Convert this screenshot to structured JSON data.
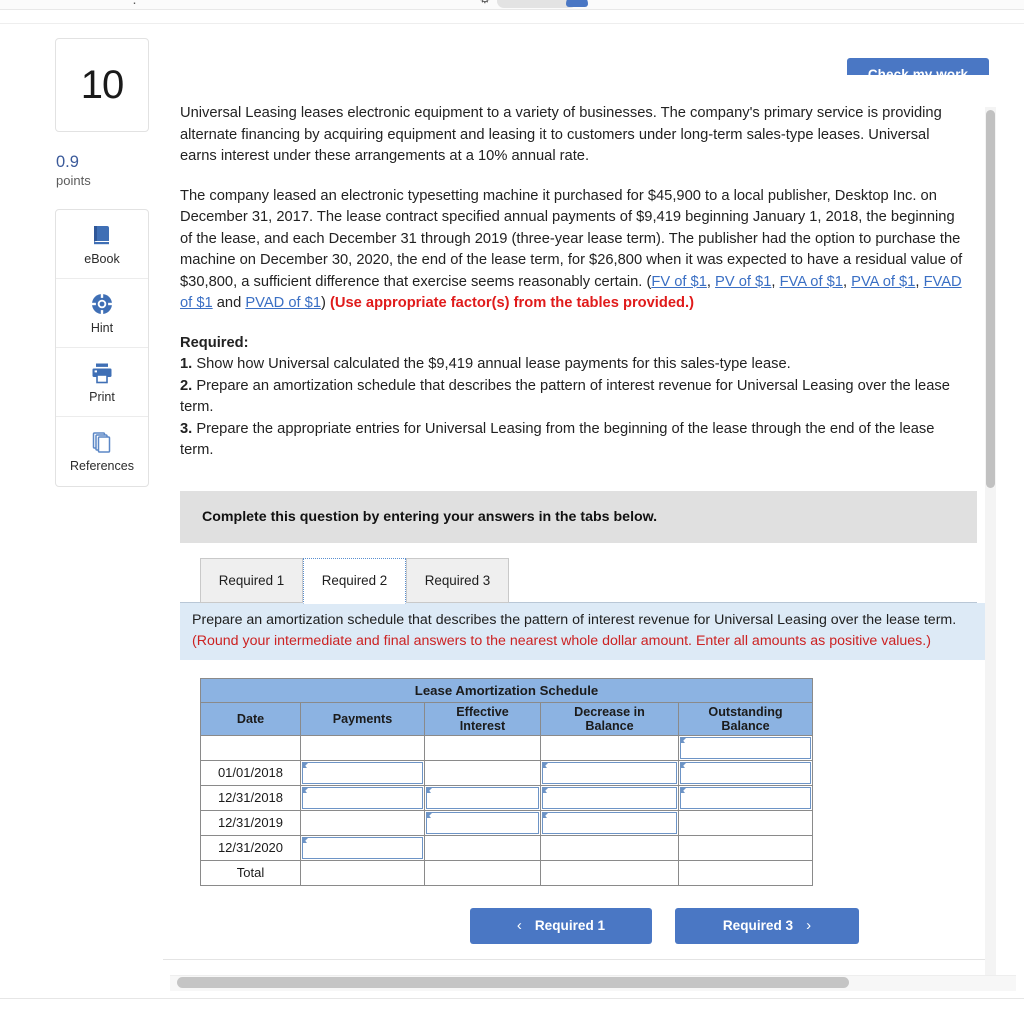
{
  "toolbar": {
    "blue_marker_icon": "blue-bookmark-icon",
    "pill_icon": "grey-pill-tab",
    "glyphs": [
      "search-icon",
      "menu-icon"
    ]
  },
  "header": {
    "check_my_work_label": "Check my work"
  },
  "sidebar": {
    "question_number": "10",
    "points_value": "0.9",
    "points_label": "points",
    "tools": [
      {
        "icon": "ebook-icon",
        "label": "eBook"
      },
      {
        "icon": "hint-lifering-icon",
        "label": "Hint"
      },
      {
        "icon": "printer-icon",
        "label": "Print"
      },
      {
        "icon": "references-copy-icon",
        "label": "References"
      }
    ]
  },
  "question": {
    "paragraph1": "Universal Leasing leases electronic equipment to a variety of businesses. The company's primary service is providing alternate financing by acquiring equipment and leasing it to customers under long-term sales-type leases. Universal earns interest under these arrangements at a 10% annual rate.",
    "paragraph2_pre": "The company leased an electronic typesetting machine it purchased for $45,900 to a local publisher, Desktop Inc. on December 31, 2017. The lease contract specified annual payments of $9,419 beginning January 1, 2018, the beginning of the lease, and each December 31 through 2019 (three-year lease term). The publisher had the option to purchase the machine on December 30, 2020, the end of the lease term, for $26,800 when it was expected to have a residual value of $30,800, a sufficient difference that exercise seems reasonably certain. (",
    "links": [
      "FV of $1",
      "PV of $1",
      "FVA of $1",
      "PVA of $1",
      "FVAD of $1",
      "PVAD of $1"
    ],
    "link_joiner": " and ",
    "paragraph2_close": ") ",
    "use_factors_note": "(Use appropriate factor(s) from the tables provided.)",
    "required_heading": "Required:",
    "req1_num": "1.",
    "req1_text": " Show how Universal calculated the $9,419 annual lease payments for this sales-type lease.",
    "req2_num": "2.",
    "req2_text": " Prepare an amortization schedule that describes the pattern of interest revenue for Universal Leasing over the lease term.",
    "req3_num": "3.",
    "req3_text": " Prepare the appropriate entries for Universal Leasing from the beginning of the lease through the end of the lease term."
  },
  "answer_area": {
    "banner": "Complete this question by entering your answers in the tabs below.",
    "tabs": [
      {
        "label": "Required 1",
        "active": false
      },
      {
        "label": "Required 2",
        "active": true
      },
      {
        "label": "Required 3",
        "active": false
      }
    ],
    "instruction_line1": "Prepare an amortization schedule that describes the pattern of interest revenue for Universal Leasing over the lease term.",
    "instruction_line2": "(Round your intermediate and final answers to the nearest whole dollar amount. Enter all amounts as positive values.)",
    "prev_button": "Required 1",
    "next_button": "Required 3",
    "prev_chevron": "‹",
    "next_chevron": "›"
  },
  "table": {
    "title": "Lease Amortization Schedule",
    "columns": [
      "Date",
      "Payments",
      "Effective Interest",
      "Decrease in Balance",
      "Outstanding Balance"
    ],
    "column_lines": [
      [
        "Date"
      ],
      [
        "Payments"
      ],
      [
        "Effective",
        "Interest"
      ],
      [
        "Decrease in",
        "Balance"
      ],
      [
        "Outstanding",
        "Balance"
      ]
    ],
    "rows": [
      {
        "date": "",
        "payments": "",
        "effective_interest": "",
        "decrease_in_balance": "",
        "outstanding_balance": "",
        "editable": [
          false,
          false,
          false,
          true
        ]
      },
      {
        "date": "01/01/2018",
        "payments": "",
        "effective_interest": "",
        "decrease_in_balance": "",
        "outstanding_balance": "",
        "editable": [
          true,
          false,
          true,
          true
        ]
      },
      {
        "date": "12/31/2018",
        "payments": "",
        "effective_interest": "",
        "decrease_in_balance": "",
        "outstanding_balance": "",
        "editable": [
          true,
          true,
          true,
          true
        ]
      },
      {
        "date": "12/31/2019",
        "payments": "",
        "effective_interest": "",
        "decrease_in_balance": "",
        "outstanding_balance": "",
        "editable": [
          false,
          true,
          true,
          false
        ]
      },
      {
        "date": "12/31/2020",
        "payments": "",
        "effective_interest": "",
        "decrease_in_balance": "",
        "outstanding_balance": "",
        "editable": [
          true,
          false,
          false,
          false
        ]
      }
    ],
    "total_label": "Total",
    "total_row": {
      "payments": "",
      "effective_interest": "",
      "decrease_in_balance": "",
      "outstanding_balance": ""
    },
    "colors": {
      "header_blue": "#8cb3e2",
      "input_border": "#6d94c6",
      "grid": "#8a8a8a"
    }
  },
  "scrollbars": {
    "vertical": "vertical-scrollbar",
    "horizontal": "horizontal-scrollbar"
  }
}
